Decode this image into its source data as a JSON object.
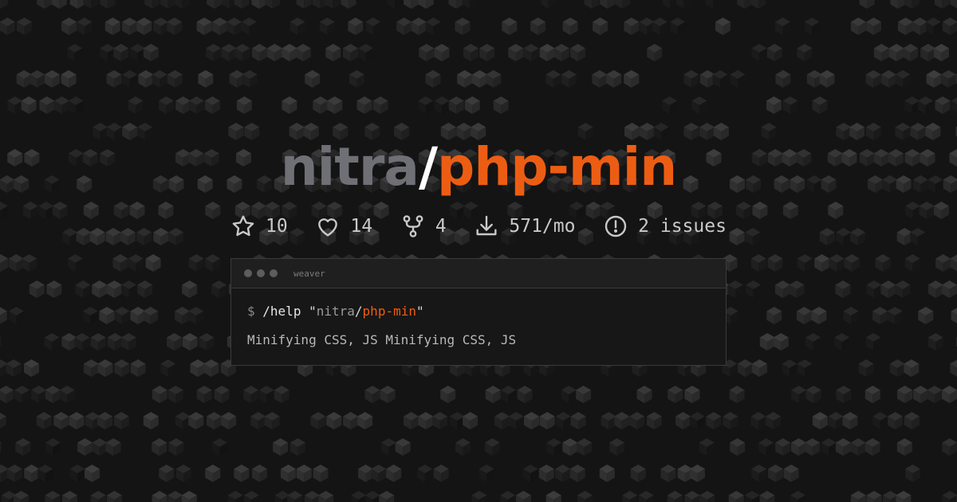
{
  "title": {
    "owner": "nitra",
    "slash": "/",
    "repo": "php-min"
  },
  "stats": [
    {
      "icon": "star-icon",
      "value": "10"
    },
    {
      "icon": "heart-icon",
      "value": "14"
    },
    {
      "icon": "fork-icon",
      "value": "4"
    },
    {
      "icon": "download-icon",
      "value": "571/mo"
    },
    {
      "icon": "issue-icon",
      "value": "2 issues"
    }
  ],
  "terminal": {
    "title": "weaver",
    "prompt": "$",
    "command": "/help",
    "arg_owner": "nitra",
    "arg_slash": "/",
    "arg_repo": "php-min",
    "output": "Minifying CSS, JS Minifying CSS, JS"
  },
  "colors": {
    "accent": "#ec5d13",
    "owner": "#6f6f76",
    "background": "#141414"
  }
}
